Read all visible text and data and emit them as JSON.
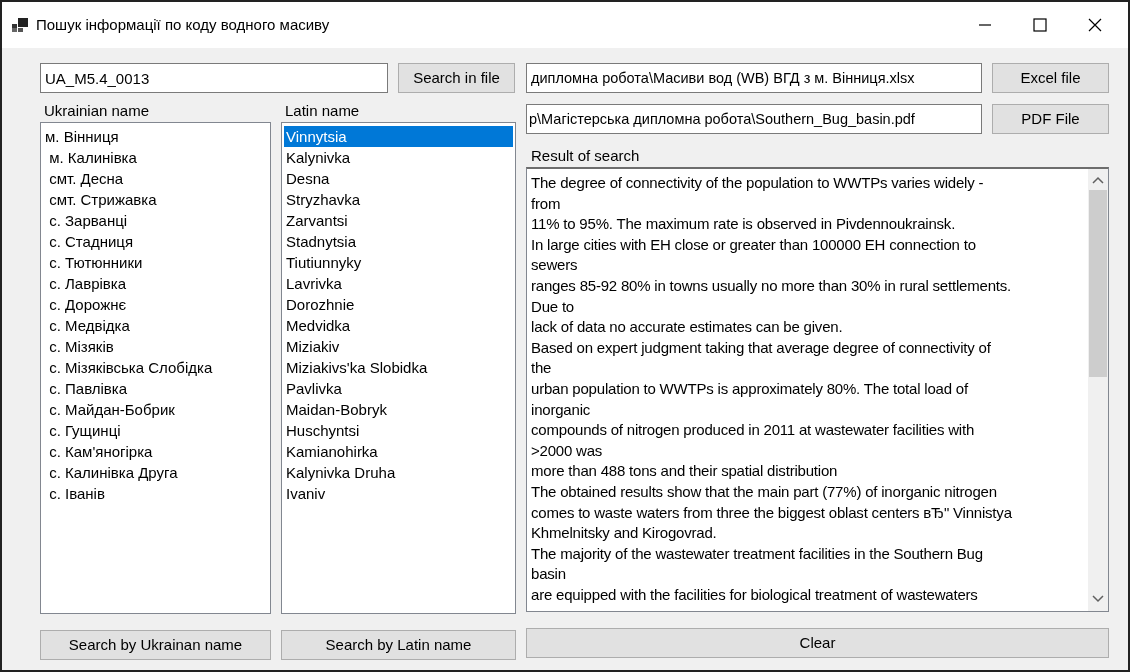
{
  "window": {
    "title": "Пошук інформації по коду водного масиву"
  },
  "code_field": {
    "value": "UA_M5.4_0013"
  },
  "search_in_file_button": "Search in file",
  "excel_path": {
    "value": "дипломна робота\\Масиви вод (WB) ВГД з м. Вінниця.xlsx"
  },
  "excel_button": "Excel file",
  "pdf_path": {
    "value": "р\\Магістерська дипломна робота\\Southern_Bug_basin.pdf"
  },
  "pdf_button": "PDF File",
  "ukrainian_list": {
    "label": "Ukrainian name",
    "items": [
      {
        "text": "м. Вінниця",
        "selected": false
      },
      {
        "text": " м. Калинівка",
        "selected": false
      },
      {
        "text": " смт. Десна",
        "selected": false
      },
      {
        "text": " смт. Стрижавка",
        "selected": false
      },
      {
        "text": " с. Зарванці",
        "selected": false
      },
      {
        "text": " с. Стадниця",
        "selected": false
      },
      {
        "text": " с. Тютюнники",
        "selected": false
      },
      {
        "text": " с. Лаврівка",
        "selected": false
      },
      {
        "text": " с. Дорожнє",
        "selected": false
      },
      {
        "text": " с. Медвідка",
        "selected": false
      },
      {
        "text": " с. Мізяків",
        "selected": false
      },
      {
        "text": " с. Мізяківська Слобідка",
        "selected": false
      },
      {
        "text": " с. Павлівка",
        "selected": false
      },
      {
        "text": " с. Майдан-Бобрик",
        "selected": false
      },
      {
        "text": " с. Гущинці",
        "selected": false
      },
      {
        "text": " с. Кам'яногірка",
        "selected": false
      },
      {
        "text": " с. Калинівка Друга",
        "selected": false
      },
      {
        "text": " с. Іванів",
        "selected": false
      }
    ]
  },
  "latin_list": {
    "label": "Latin name",
    "items": [
      {
        "text": "Vinnytsia",
        "selected": true
      },
      {
        "text": "Kalynivka",
        "selected": false
      },
      {
        "text": "Desna",
        "selected": false
      },
      {
        "text": "Stryzhavka",
        "selected": false
      },
      {
        "text": "Zarvantsi",
        "selected": false
      },
      {
        "text": "Stadnytsia",
        "selected": false
      },
      {
        "text": "Tiutiunnyky",
        "selected": false
      },
      {
        "text": "Lavrivka",
        "selected": false
      },
      {
        "text": "Dorozhnie",
        "selected": false
      },
      {
        "text": "Medvidka",
        "selected": false
      },
      {
        "text": "Miziakiv",
        "selected": false
      },
      {
        "text": "Miziakivs'ka Slobidka",
        "selected": false
      },
      {
        "text": "Pavlivka",
        "selected": false
      },
      {
        "text": "Maidan-Bobryk",
        "selected": false
      },
      {
        "text": "Huschyntsi",
        "selected": false
      },
      {
        "text": "Kamianohirka",
        "selected": false
      },
      {
        "text": "Kalynivka Druha",
        "selected": false
      },
      {
        "text": "Ivaniv",
        "selected": false
      }
    ]
  },
  "result": {
    "label": "Result of search",
    "lines": [
      "The degree of connectivity of the population to WWTPs varies widely -",
      "from",
      "11% to 95%. The maximum rate is observed in Pivdennoukrainsk.",
      "In large cities with EH close or greater than 100000 EH connection to",
      "sewers",
      "ranges 85-92 80% in towns usually no more than 30% in rural settlements.",
      "Due to",
      "lack of data no accurate estimates can be given.",
      "Based on expert judgment taking that average degree of connectivity of",
      "the",
      "urban population to WWTPs is approximately 80%. The total load of",
      "inorganic",
      "compounds of nitrogen produced in 2011 at wastewater facilities with",
      ">2000 was",
      "more than 488 tons and their spatial distribution",
      "The obtained results show that the main part (77%) of inorganic nitrogen",
      "comes to waste waters from three the biggest oblast centers вЂ\" Vinnistya",
      "Khmelnitsky and Kirogovrad.",
      "The majority of the wastewater treatment facilities in the Southern Bug",
      "basin",
      "are equipped with the facilities for biological treatment of wastewaters"
    ]
  },
  "bottom_buttons": [
    "Search by Ukrainan name",
    "Search by Latin name",
    "Clear"
  ]
}
